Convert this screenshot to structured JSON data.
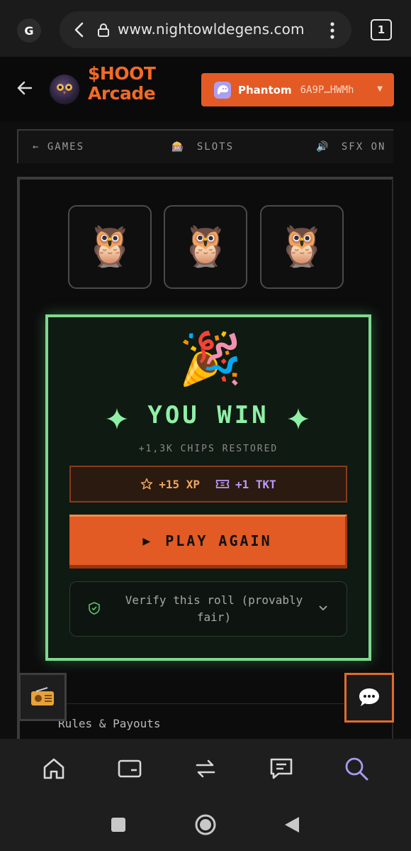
{
  "browser": {
    "profile_initial": "G",
    "url": "www.nightowldegens.com",
    "tab_count": "1"
  },
  "app": {
    "title_line1": "$HOOT",
    "title_line2": "Arcade",
    "wallet": {
      "name": "Phantom",
      "address": "6A9P…HWMh"
    }
  },
  "game_nav": {
    "back_label": "← GAMES",
    "current_label": "SLOTS",
    "sfx_label": "SFX ON"
  },
  "reels": [
    "🦉",
    "🦉",
    "🦉"
  ],
  "result": {
    "icon": "🎉",
    "title": "YOU WIN",
    "subtitle": "+1,3K CHIPS RESTORED",
    "xp_reward": "+15 XP",
    "ticket_reward": "+1 TKT",
    "play_again_label": "PLAY AGAIN",
    "verify_label": "Verify this roll (provably fair)"
  },
  "rules_label": "Rules & Payouts",
  "colors": {
    "accent": "#e35a25",
    "win_green": "#8ef0a6",
    "ticket_purple": "#b99af7"
  },
  "bottom_nav_icons": [
    "home-icon",
    "wallet-icon",
    "swap-icon",
    "chat-icon",
    "search-icon"
  ],
  "system_nav_icons": [
    "recents-icon",
    "home-circle-icon",
    "back-triangle-icon"
  ]
}
